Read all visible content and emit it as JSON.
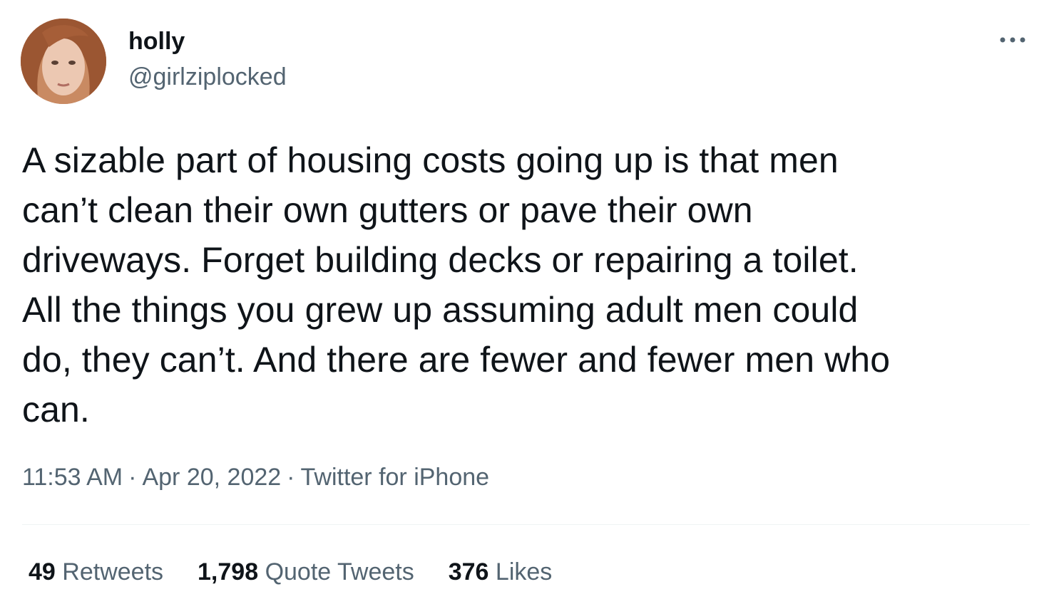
{
  "user": {
    "display_name": "holly",
    "handle": "@girlziplocked",
    "avatar_icon": "profile-photo"
  },
  "tweet": {
    "text": "A sizable part of housing costs going up is that men\ncan’t clean their own gutters or pave their own\ndriveways. Forget building decks or repairing a toilet.\nAll the things you grew up assuming adult men could\ndo, they can’t. And there are fewer and fewer men who\ncan.",
    "time": "11:53 AM",
    "date": "Apr 20, 2022",
    "source": "Twitter for iPhone",
    "separator": "·"
  },
  "stats": {
    "retweets_count": "49",
    "retweets_label": "Retweets",
    "quotes_count": "1,798",
    "quotes_label": "Quote Tweets",
    "likes_count": "376",
    "likes_label": "Likes"
  },
  "icons": {
    "more": "more-horizontal-icon"
  },
  "colors": {
    "text_primary": "#0f1419",
    "text_secondary": "#536471",
    "divider": "#eff3f4"
  }
}
